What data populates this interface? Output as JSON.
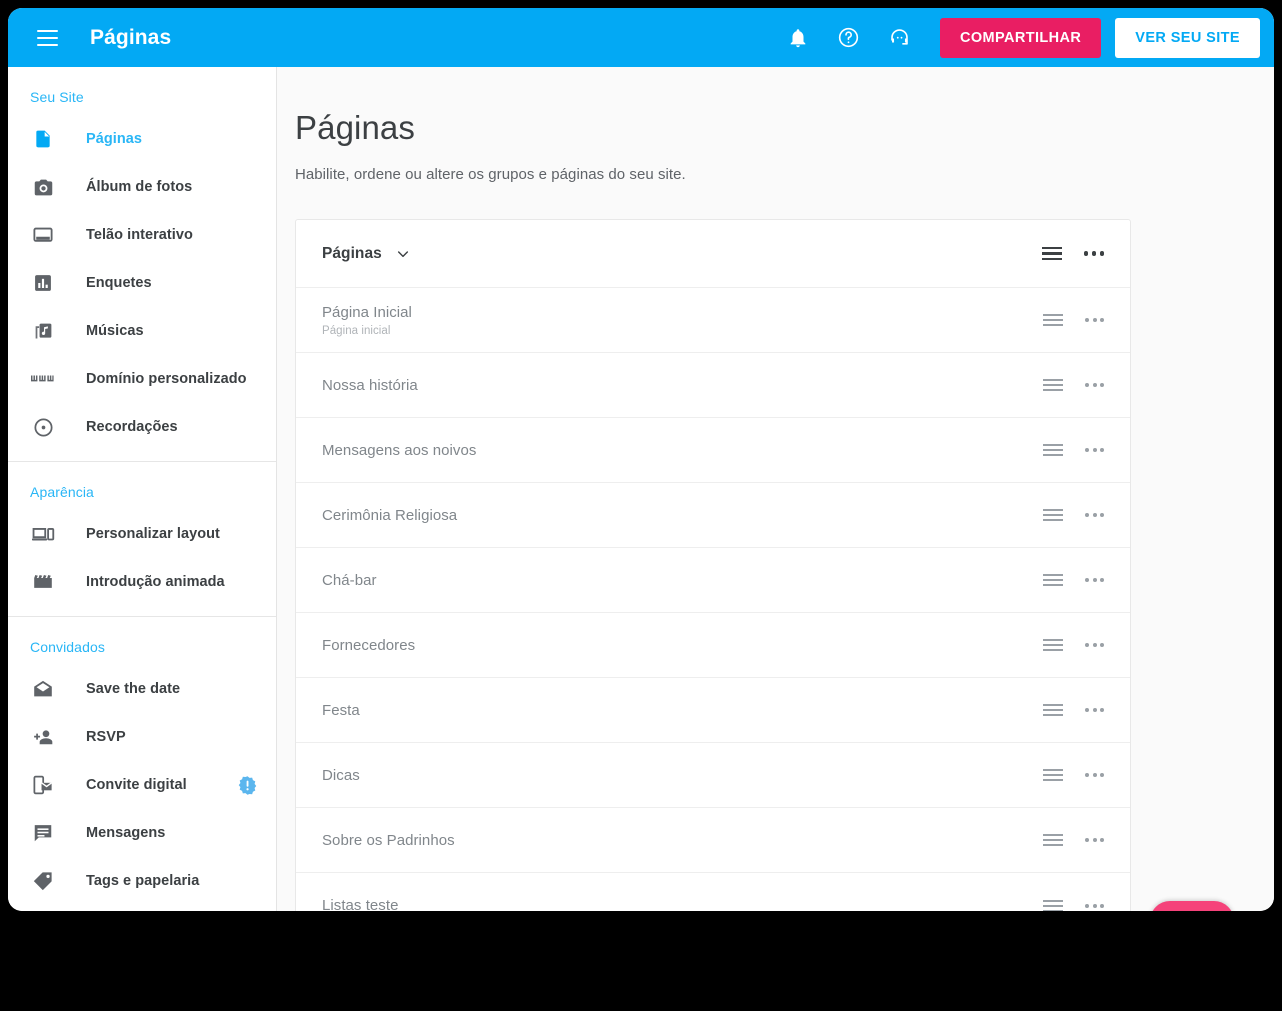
{
  "appbar": {
    "menu_icon": "hamburger-menu-icon",
    "title": "Páginas",
    "icons": [
      {
        "name": "notifications-bell-icon"
      },
      {
        "name": "help-circle-icon"
      },
      {
        "name": "support-agent-icon"
      }
    ],
    "share_button": "COMPARTILHAR",
    "view_site_button": "VER SEU SITE",
    "bg_color": "#03A9F4",
    "share_color": "#E91E63",
    "view_button_text_color": "#03A9F4"
  },
  "sidebar": {
    "accent_color": "#29B6F6",
    "sections": [
      {
        "header": "Seu Site",
        "items": [
          {
            "label": "Páginas",
            "icon": "document-file-icon",
            "active": true
          },
          {
            "label": "Álbum de fotos",
            "icon": "camera-icon",
            "active": false
          },
          {
            "label": "Telão interativo",
            "icon": "screen-monitor-icon",
            "active": false
          },
          {
            "label": "Enquetes",
            "icon": "bar-chart-icon",
            "active": false
          },
          {
            "label": "Músicas",
            "icon": "music-library-icon",
            "active": false
          },
          {
            "label": "Domínio personalizado",
            "icon": "www-icon",
            "active": false
          },
          {
            "label": "Recordações",
            "icon": "disc-circle-icon",
            "active": false
          }
        ]
      },
      {
        "header": "Aparência",
        "items": [
          {
            "label": "Personalizar layout",
            "icon": "devices-layout-icon",
            "active": false
          },
          {
            "label": "Introdução animada",
            "icon": "clapperboard-icon",
            "active": false
          }
        ]
      },
      {
        "header": "Convidados",
        "items": [
          {
            "label": "Save the date",
            "icon": "envelope-open-icon",
            "active": false
          },
          {
            "label": "RSVP",
            "icon": "person-add-icon",
            "active": false
          },
          {
            "label": "Convite digital",
            "icon": "mobile-invite-icon",
            "active": false,
            "badge": "alert-badge-icon"
          },
          {
            "label": "Mensagens",
            "icon": "chat-message-icon",
            "active": false
          },
          {
            "label": "Tags e papelaria",
            "icon": "tag-label-icon",
            "active": false
          }
        ]
      }
    ]
  },
  "main": {
    "title": "Páginas",
    "subtitle": "Habilite, ordene ou altere os grupos e páginas do seu site.",
    "card": {
      "header": {
        "title": "Páginas",
        "chevron_icon": "chevron-down-icon",
        "drag_icon": "drag-handle-icon",
        "more_icon": "more-options-icon"
      },
      "rows": [
        {
          "title": "Página Inicial",
          "subtitle": "Página inicial"
        },
        {
          "title": "Nossa história",
          "subtitle": ""
        },
        {
          "title": "Mensagens aos noivos",
          "subtitle": ""
        },
        {
          "title": "Cerimônia Religiosa",
          "subtitle": ""
        },
        {
          "title": "Chá-bar",
          "subtitle": ""
        },
        {
          "title": "Fornecedores",
          "subtitle": ""
        },
        {
          "title": "Festa",
          "subtitle": ""
        },
        {
          "title": "Dicas",
          "subtitle": ""
        },
        {
          "title": "Sobre os Padrinhos",
          "subtitle": ""
        },
        {
          "title": "Listas teste",
          "subtitle": ""
        }
      ]
    },
    "fab": {
      "name": "add-page-fab",
      "color": "#F5427A"
    }
  }
}
